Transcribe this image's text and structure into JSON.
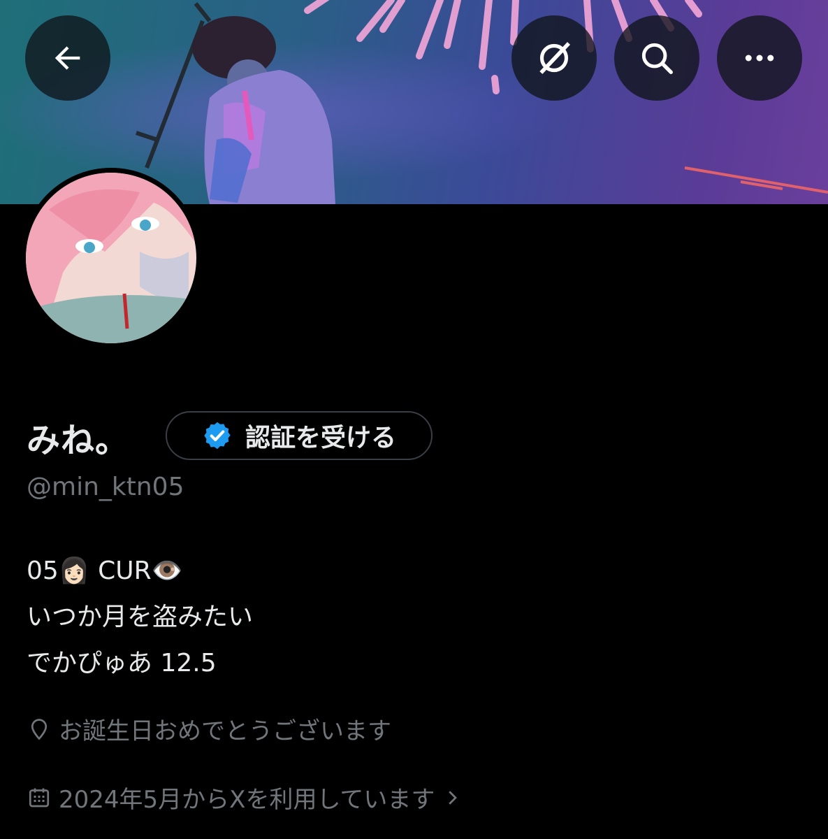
{
  "header": {
    "back_icon": "arrow-left-icon",
    "grok_icon": "grok-icon",
    "search_icon": "search-icon",
    "more_icon": "more-horizontal-icon"
  },
  "profile": {
    "display_name": "みね。",
    "handle": "@min_ktn05",
    "verify_button_label": "認証を受ける",
    "verify_badge_color": "#1d9bf0",
    "bio_lines": [
      "05👩🏻 CUR👁️",
      "いつか月を盗みたい",
      "でかぴゅあ 12.5"
    ],
    "location": "お誕生日おめでとうございます",
    "joined": "2024年5月からXを利用しています"
  },
  "colors": {
    "background": "#000000",
    "primary_text": "#e7e9ea",
    "secondary_text": "#71767b",
    "accent": "#1d9bf0"
  }
}
